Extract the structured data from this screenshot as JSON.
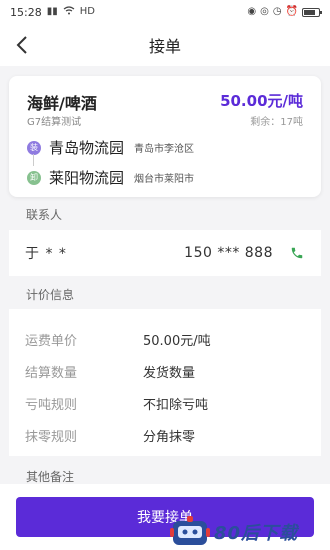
{
  "statusbar": {
    "time": "15:28"
  },
  "nav": {
    "title": "接单"
  },
  "order": {
    "cargo": "海鲜/啤酒",
    "settlement": "G7结算测试",
    "price": "50.00元/吨",
    "remaining": "剩余：17吨",
    "load": {
      "badge": "装",
      "name": "青岛物流园",
      "city": "青岛市李沧区"
    },
    "unload": {
      "badge": "卸",
      "name": "莱阳物流园",
      "city": "烟台市莱阳市"
    }
  },
  "contact": {
    "section": "联系人",
    "name": "于 * *",
    "phone": "150 *** 888"
  },
  "pricing": {
    "section": "计价信息",
    "rows": [
      {
        "k": "运费单价",
        "v": "50.00元/吨"
      },
      {
        "k": "结算数量",
        "v": "发货数量"
      },
      {
        "k": "亏吨规则",
        "v": "不扣除亏吨"
      },
      {
        "k": "抹零规则",
        "v": "分角抹零"
      }
    ]
  },
  "remarks": {
    "section": "其他备注"
  },
  "cta": {
    "label": "我要接单"
  },
  "watermark": {
    "text": "80后下载"
  },
  "colors": {
    "accent": "#5b2bd8",
    "load_dot": "#8f7be0",
    "unload_dot": "#87c18f",
    "call_icon": "#3aa655",
    "watermark": "#2b4e9b"
  }
}
